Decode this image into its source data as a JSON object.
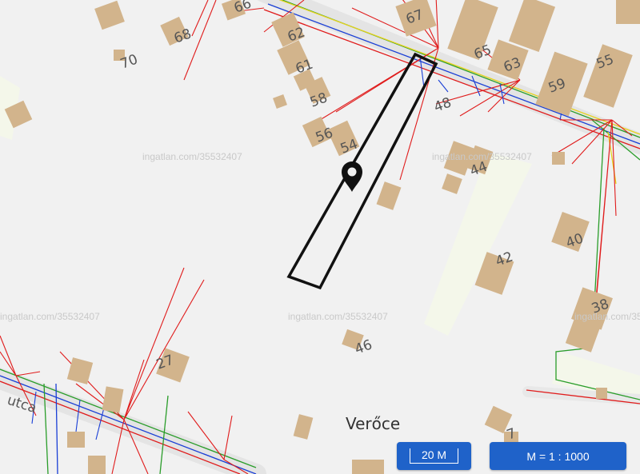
{
  "map": {
    "place_name": "Verőce",
    "watermark": "ingatlan.com/35532407",
    "house_numbers": {
      "n66": "66",
      "n68": "68",
      "n70": "70",
      "n62": "62",
      "n61": "61",
      "n58": "58",
      "n56": "56",
      "n54": "54",
      "n67": "67",
      "n65": "65",
      "n63": "63",
      "n59": "59",
      "n55": "55",
      "n48": "48",
      "n44": "44",
      "n40": "40",
      "n42": "42",
      "n38": "38",
      "n46": "46",
      "n27": "27",
      "n7": "7"
    },
    "street_fragment": "utca",
    "colors": {
      "building": "#d2b48c",
      "parcel": "#111111",
      "pin": "#111111"
    }
  },
  "controls": {
    "scale_label": "20 M",
    "ratio_label": "M = 1 : 1000",
    "accent": "#1f62c9"
  }
}
